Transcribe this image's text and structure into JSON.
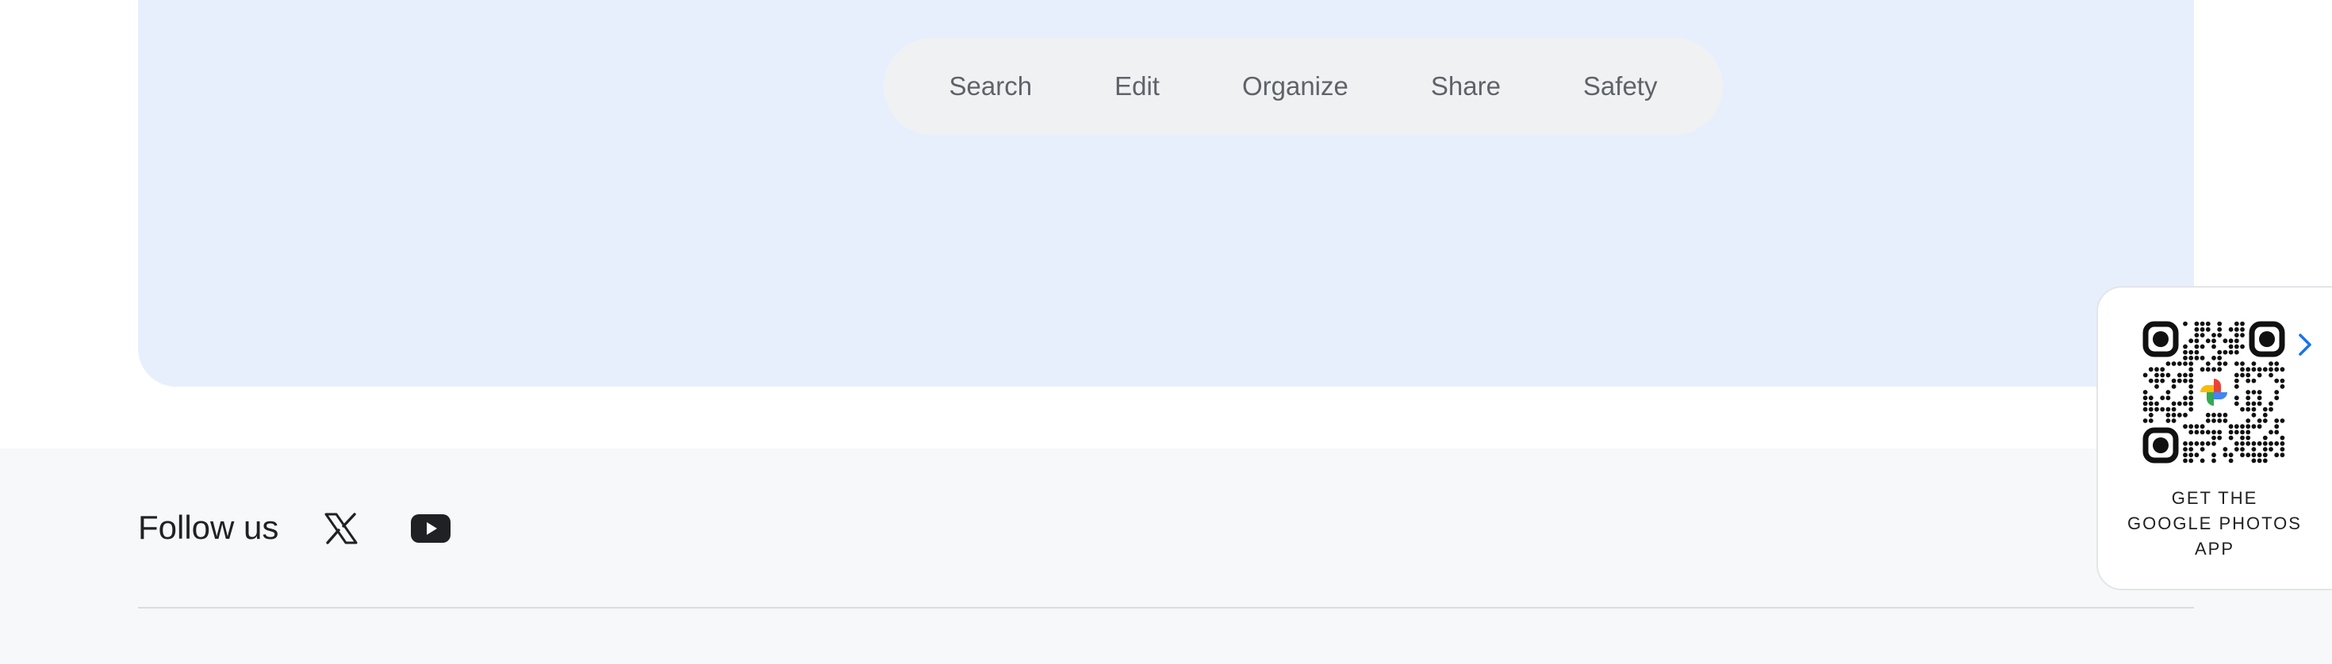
{
  "nav": {
    "tabs": [
      {
        "label": "Search"
      },
      {
        "label": "Edit"
      },
      {
        "label": "Organize"
      },
      {
        "label": "Share"
      },
      {
        "label": "Safety"
      }
    ]
  },
  "footer": {
    "follow_label": "Follow us",
    "social": [
      {
        "name": "x-icon"
      },
      {
        "name": "youtube-icon"
      }
    ]
  },
  "promo": {
    "lines": [
      "GET THE",
      "GOOGLE PHOTOS",
      "APP"
    ],
    "icon": "google-photos-pinwheel-icon"
  },
  "colors": {
    "hero_bg": "#e8effc",
    "tab_text": "#5f6368",
    "chevron": "#1a73e8",
    "footer_bg": "#f7f8fa"
  }
}
